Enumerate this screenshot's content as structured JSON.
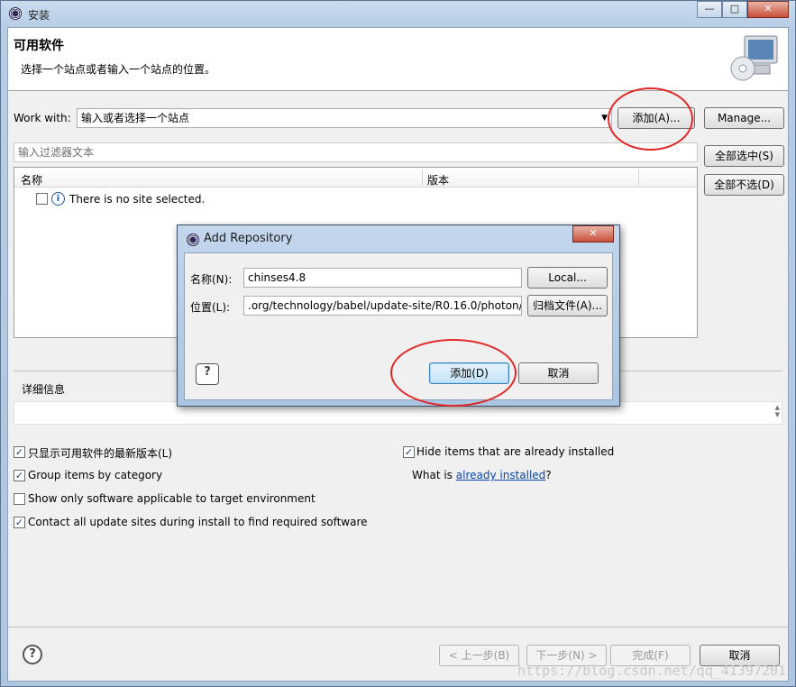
{
  "window": {
    "title": "安装"
  },
  "header": {
    "title": "可用软件",
    "description": "选择一个站点或者输入一个站点的位置。"
  },
  "work_with": {
    "label": "Work with:",
    "placeholder": "输入或者选择一个站点",
    "add_label": "添加(A)...",
    "manage_label": "Manage..."
  },
  "filter": {
    "placeholder": "输入过滤器文本"
  },
  "table": {
    "columns": [
      "名称",
      "版本"
    ],
    "rows": [
      {
        "name": "There is no site selected."
      }
    ]
  },
  "side_buttons": {
    "select_all": "全部选中(S)",
    "deselect_all": "全部不选(D)"
  },
  "details": {
    "label": "详细信息"
  },
  "options": {
    "show_latest": "只显示可用软件的最新版本(L)",
    "group_by_category": "Group items by category",
    "show_applicable": "Show only software applicable to target environment",
    "contact_all": "Contact all update sites during install to find required software",
    "hide_installed": "Hide items that are already installed",
    "what_is_prefix": "What is ",
    "already_installed_link": "already installed",
    "what_is_suffix": "?"
  },
  "footer": {
    "back": "< 上一步(B)",
    "next": "下一步(N) >",
    "finish": "完成(F)",
    "cancel": "取消"
  },
  "dialog": {
    "title": "Add Repository",
    "name_label": "名称(N):",
    "name_value": "chinses4.8",
    "location_label": "位置(L):",
    "location_value": ".org/technology/babel/update-site/R0.16.0/photon/",
    "local_button": "Local...",
    "archive_button": "归档文件(A)...",
    "add_button": "添加(D)",
    "cancel_button": "取消"
  },
  "watermark": "https://blog.csdn.net/qq_41397201",
  "colors": {
    "annotation": "#e32626",
    "link": "#0645ad"
  }
}
